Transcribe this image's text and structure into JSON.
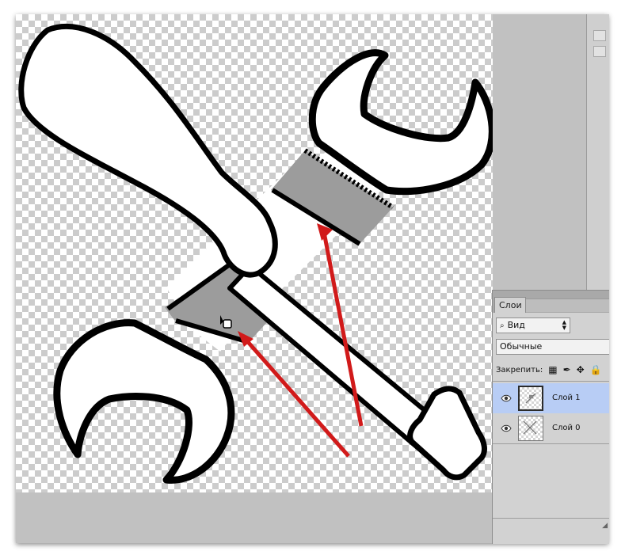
{
  "layers_panel": {
    "tab_label": "Слои",
    "kind_filter": "Вид",
    "blend_mode": "Обычные",
    "lock_label": "Закрепить:",
    "layers": [
      {
        "name": "Слой 1",
        "selected": true,
        "visible": true
      },
      {
        "name": "Слой 0",
        "selected": false,
        "visible": true
      }
    ],
    "selected_color": "#b8cdf5"
  },
  "canvas": {
    "selection_fill": "#9c9c9c",
    "arrow_color": "#d11a1a"
  },
  "icons": {
    "eye": "eye-icon",
    "lock_transparent": "checker-lock-icon",
    "lock_paint": "brush-lock-icon",
    "lock_move": "move-lock-icon",
    "lock_all": "padlock-icon",
    "search": "magnifier-icon",
    "cursor": "paint-bucket-cursor-icon"
  }
}
